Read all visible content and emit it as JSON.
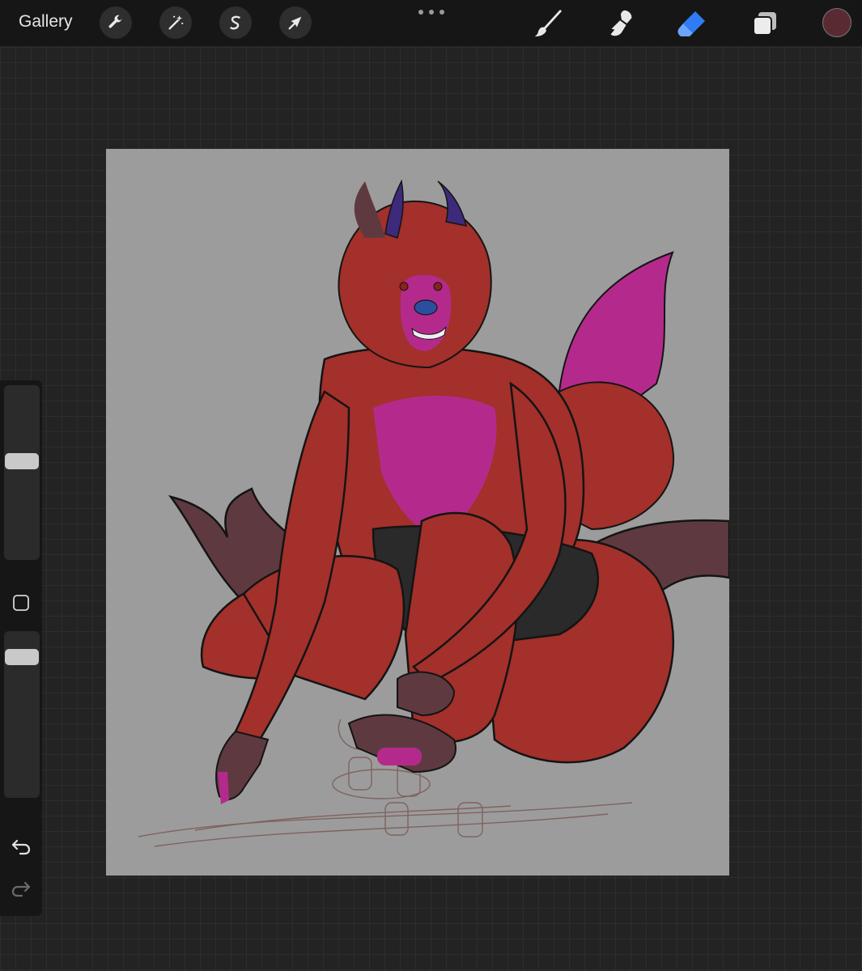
{
  "topbar": {
    "gallery_label": "Gallery",
    "left_tools": [
      {
        "name": "actions",
        "icon": "wrench-icon"
      },
      {
        "name": "adjustments",
        "icon": "magic-wand-icon"
      },
      {
        "name": "selection",
        "icon": "selection-s-icon"
      },
      {
        "name": "transform",
        "icon": "arrow-cursor-icon"
      }
    ],
    "more_icon": "more-dots-icon",
    "right_tools": [
      {
        "name": "brush",
        "icon": "brush-icon",
        "active": false
      },
      {
        "name": "smudge",
        "icon": "smudge-icon",
        "active": false
      },
      {
        "name": "eraser",
        "icon": "eraser-icon",
        "active": true
      },
      {
        "name": "layers",
        "icon": "layers-icon",
        "active": false
      }
    ],
    "current_color": "#5a2a33",
    "active_tool_color": "#2f7cf6"
  },
  "sidebar": {
    "brush_size_level": 0.57,
    "opacity_level": 0.88,
    "modifier_icon": "square-modifier-icon",
    "undo_icon": "undo-icon",
    "redo_icon": "redo-icon"
  },
  "canvas": {
    "background_color": "#9c9c9c",
    "artwork": "artwork-image",
    "palette": {
      "fur": "#a3302a",
      "fur_dark": "#8a221e",
      "tail_dark": "#5e3a40",
      "accent_pink": "#b42a8c",
      "horn_purple": "#3d2a7a",
      "nose_blue": "#2c4e9e",
      "shorts": "#2a2a2a",
      "outline": "#141414",
      "sketch": "#7a5a55"
    }
  }
}
